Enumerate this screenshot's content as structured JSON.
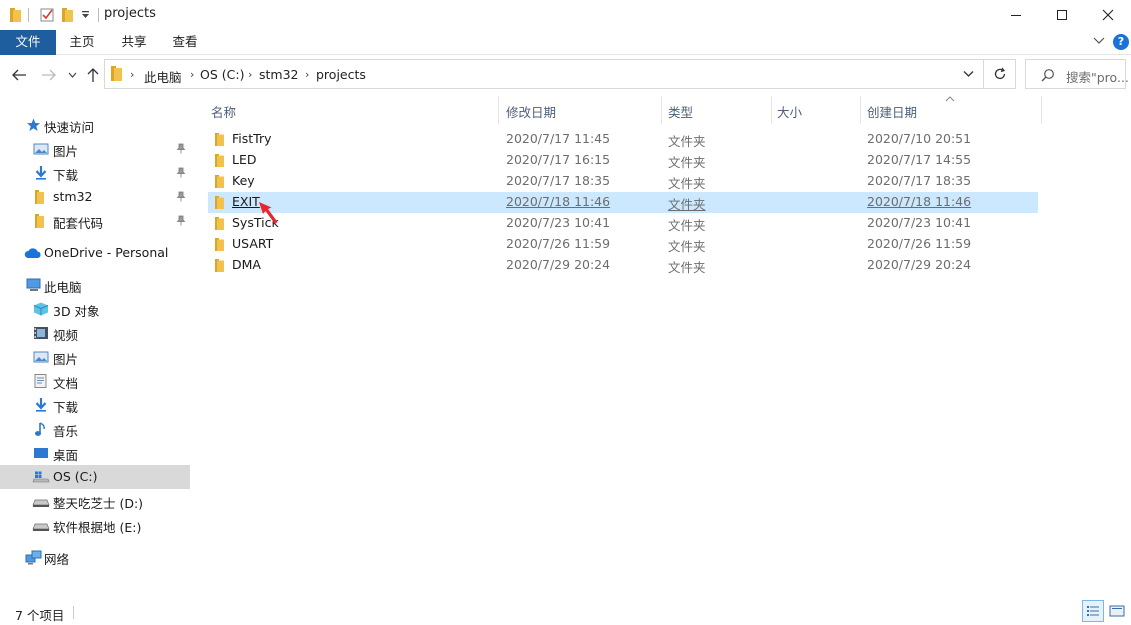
{
  "window": {
    "title": "projects"
  },
  "ribbon": {
    "tabs": [
      {
        "label": "文件"
      },
      {
        "label": "主页"
      },
      {
        "label": "共享"
      },
      {
        "label": "查看"
      }
    ]
  },
  "address": {
    "crumbs": [
      "此电脑",
      "OS (C:)",
      "stm32",
      "projects"
    ],
    "search_placeholder": "搜索\"pro..."
  },
  "nav": {
    "quick_access": "快速访问",
    "quick_items": [
      "图片",
      "下载",
      "stm32",
      "配套代码"
    ],
    "onedrive": "OneDrive - Personal",
    "this_pc": "此电脑",
    "pc_items": [
      "3D 对象",
      "视频",
      "图片",
      "文档",
      "下载",
      "音乐",
      "桌面",
      "OS (C:)",
      "整天吃芝士 (D:)",
      "软件根据地 (E:)"
    ],
    "network": "网络",
    "selected_item": "OS (C:)"
  },
  "columns": {
    "name": "名称",
    "modified": "修改日期",
    "type": "类型",
    "size": "大小",
    "created": "创建日期"
  },
  "files": [
    {
      "name": "FistTry",
      "modified": "2020/7/17 11:45",
      "type": "文件夹",
      "created": "2020/7/10 20:51"
    },
    {
      "name": "LED",
      "modified": "2020/7/17 16:15",
      "type": "文件夹",
      "created": "2020/7/17 14:55"
    },
    {
      "name": "Key",
      "modified": "2020/7/17 18:35",
      "type": "文件夹",
      "created": "2020/7/17 18:35"
    },
    {
      "name": "EXIT",
      "modified": "2020/7/18 11:46",
      "type": "文件夹",
      "created": "2020/7/18 11:46"
    },
    {
      "name": "SysTick",
      "modified": "2020/7/23 10:41",
      "type": "文件夹",
      "created": "2020/7/23 10:41"
    },
    {
      "name": "USART",
      "modified": "2020/7/26 11:59",
      "type": "文件夹",
      "created": "2020/7/26 11:59"
    },
    {
      "name": "DMA",
      "modified": "2020/7/29 20:24",
      "type": "文件夹",
      "created": "2020/7/29 20:24"
    }
  ],
  "selected_file": "EXIT",
  "status": {
    "item_count": "7 个项目"
  },
  "colors": {
    "file_tab": "#1f5e9e",
    "selection": "#cce8ff",
    "nav_selection": "#d9d9d9",
    "folder": "#f3c24e",
    "arrow": "#e8262b"
  }
}
